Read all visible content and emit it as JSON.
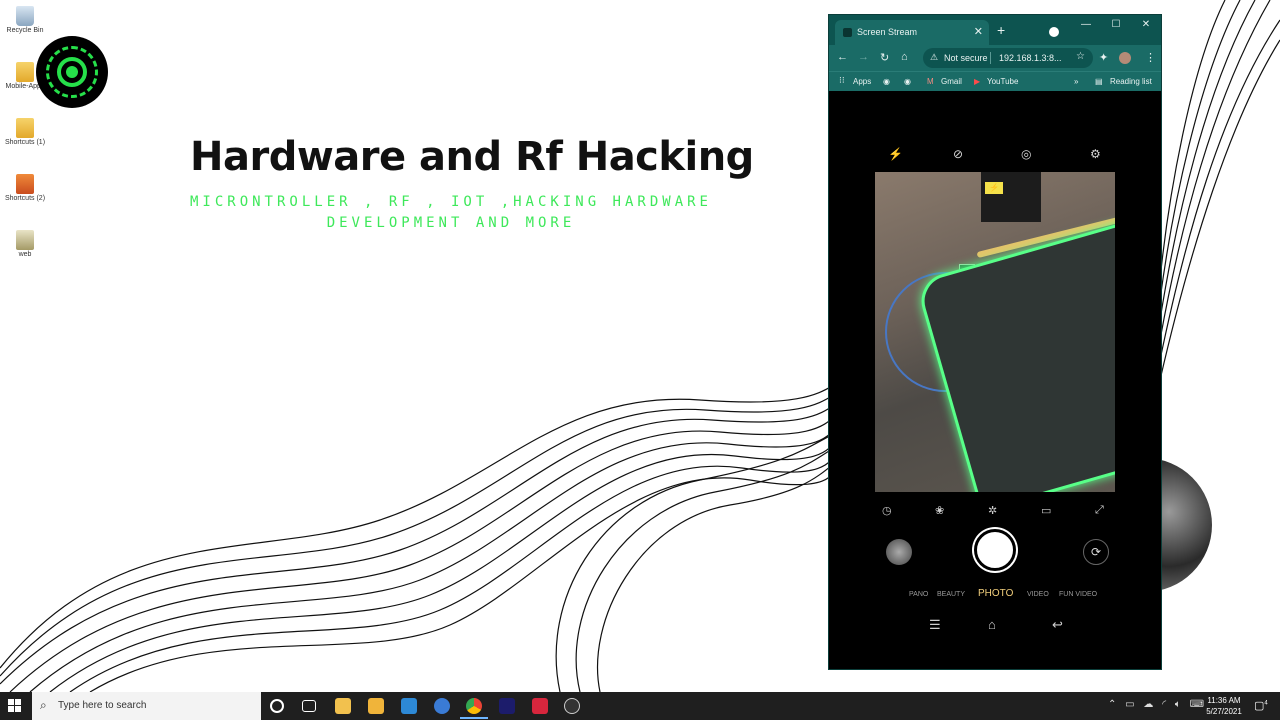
{
  "desktop": {
    "icons": [
      {
        "label": "Recycle Bin",
        "icon": "recycle-bin-icon"
      },
      {
        "label": "Mobile-Apps",
        "icon": "folder-icon"
      },
      {
        "label": "Shortcuts (1)",
        "icon": "folder-icon"
      },
      {
        "label": "Shortcuts (2)",
        "icon": "app-shortcut-icon"
      },
      {
        "label": "web",
        "icon": "config-file-icon"
      }
    ],
    "hero": {
      "title": "Hardware and Rf Hacking",
      "subtitle_line1": "MICRONTROLLER , RF , IOT ,HACKING HARDWARE",
      "subtitle_line2": "DEVELOPMENT AND MORE"
    },
    "accent_color": "#3ee85a"
  },
  "browser": {
    "tab_title": "Screen Stream",
    "address": {
      "security_label": "Not secure",
      "url": "192.168.1.3:8..."
    },
    "bookmarks": [
      {
        "label": "Apps"
      },
      {
        "label": "Gmail"
      },
      {
        "label": "YouTube"
      }
    ],
    "reading_list": "Reading list",
    "theme_color": "#1a6b66"
  },
  "camera": {
    "modes": [
      "PANO",
      "BEAUTY",
      "PHOTO",
      "VIDEO",
      "FUN VIDEO"
    ],
    "active_mode": "PHOTO"
  },
  "taskbar": {
    "search_placeholder": "Type here to search",
    "time": "11:36 AM",
    "date": "5/27/2021",
    "notifications": "4"
  }
}
